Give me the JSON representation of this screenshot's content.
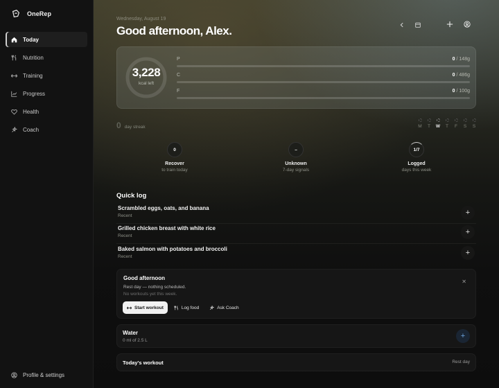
{
  "app": {
    "name": "OneRep"
  },
  "sidebar": {
    "items": [
      {
        "label": "Today",
        "icon": "home-icon",
        "active": true
      },
      {
        "label": "Nutrition",
        "icon": "fork-knife-icon",
        "active": false
      },
      {
        "label": "Training",
        "icon": "dumbbell-icon",
        "active": false
      },
      {
        "label": "Progress",
        "icon": "trend-chart-icon",
        "active": false
      },
      {
        "label": "Health",
        "icon": "heart-icon",
        "active": false
      },
      {
        "label": "Coach",
        "icon": "sparkle-icon",
        "active": false
      }
    ],
    "profile_label": "Profile & settings"
  },
  "header": {
    "date": "Wednesday, August 19",
    "greeting": "Good afternoon, Alex."
  },
  "summary": {
    "kcal_left": "3,228",
    "kcal_label": "kcal left",
    "macros": [
      {
        "label": "P",
        "current": "0",
        "target": " / 148g",
        "progress": 0
      },
      {
        "label": "C",
        "current": "0",
        "target": " / 486g",
        "progress": 0
      },
      {
        "label": "F",
        "current": "0",
        "target": " / 100g",
        "progress": 0
      }
    ]
  },
  "streak": {
    "count": "0",
    "label": "day streak"
  },
  "week": {
    "days": [
      "M",
      "T",
      "W",
      "T",
      "F",
      "S",
      "S"
    ],
    "today_index": 2
  },
  "stats": [
    {
      "value": "0",
      "title": "Recover",
      "subtitle": "to train today"
    },
    {
      "value": "–",
      "title": "Unknown",
      "subtitle": "7-day signals"
    },
    {
      "value": "1/7",
      "title": "Logged",
      "subtitle": "days this week"
    }
  ],
  "quick_log": {
    "title": "Quick log",
    "items": [
      {
        "name": "Scrambled eggs, oats, and banana",
        "tag": "Recent"
      },
      {
        "name": "Grilled chicken breast with white rice",
        "tag": "Recent"
      },
      {
        "name": "Baked salmon with potatoes and broccoli",
        "tag": "Recent"
      }
    ]
  },
  "coach_card": {
    "title": "Good afternoon",
    "line1": "Rest day — nothing scheduled.",
    "line2": "No workouts yet this week.",
    "buttons": {
      "start_workout": "Start workout",
      "log_food": "Log food",
      "ask_coach": "Ask Coach"
    }
  },
  "water": {
    "title": "Water",
    "amount": "0 ml of 2.5 L",
    "accent": "#6ea4e0"
  },
  "todays_workout": {
    "title": "Today's workout",
    "value": "Rest day"
  }
}
